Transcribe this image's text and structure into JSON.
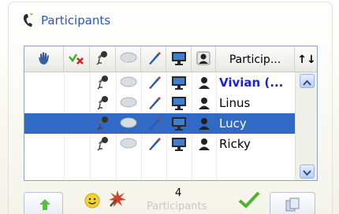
{
  "header": {
    "title": "Participants",
    "icon": "phone-handset-icon"
  },
  "columns": [
    {
      "icon": "raise-hand-icon"
    },
    {
      "icon": "check-cross-icon"
    },
    {
      "icon": "microphone-icon"
    },
    {
      "icon": "chat-bubble-icon"
    },
    {
      "icon": "pen-icon"
    },
    {
      "icon": "screen-share-icon"
    },
    {
      "icon": "webcam-user-icon"
    },
    {
      "label": "Particip..."
    },
    {
      "icon": "sort-arrows-icon",
      "label": "↑↓"
    }
  ],
  "participants": [
    {
      "name": "Vivian (...",
      "bold": true,
      "selected": false
    },
    {
      "name": "Linus",
      "bold": false,
      "selected": false
    },
    {
      "name": "Lucy",
      "bold": false,
      "selected": true
    },
    {
      "name": "Ricky",
      "bold": false,
      "selected": false
    }
  ],
  "footer": {
    "count": "4",
    "count_label": "Participants",
    "icons": [
      "upload-arrow-icon",
      "smiley-icon",
      "burst-icon",
      "checkmark-icon",
      "copy-icon"
    ]
  },
  "colors": {
    "accent": "#2a57b7",
    "selection": "#316ac5",
    "name_bold": "#1a1fe0"
  }
}
